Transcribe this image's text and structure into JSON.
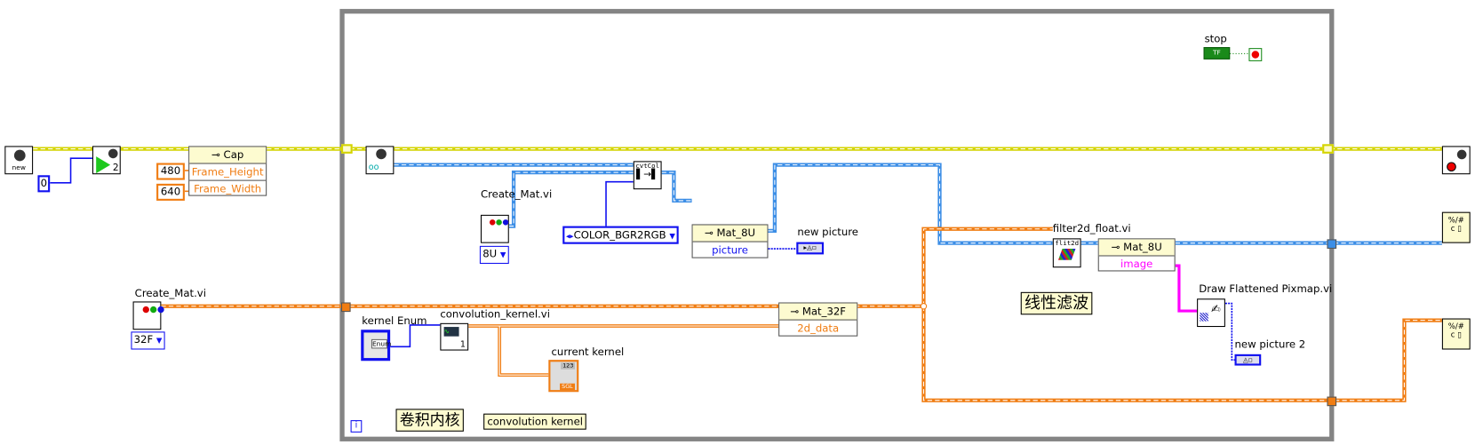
{
  "outside": {
    "new_node_text": "new",
    "camera_index_const": "0",
    "start_node_badge": "2",
    "cap_node": {
      "title": "Cap",
      "rows": [
        "Frame_Height",
        "Frame_Width"
      ]
    },
    "height_const": "480",
    "width_const": "640",
    "create_mat_label": "Create_Mat.vi",
    "create_mat_type": "32F"
  },
  "loop": {
    "stop_label": "stop",
    "stop_bool_text": "TF",
    "inner_create_mat_label": "Create_Mat.vi",
    "inner_create_mat_type": "8U",
    "cvtcolor_text": "cvtCol",
    "color_code_enum": "COLOR_BGR2RGB",
    "mat8u_node": {
      "title": "Mat_8U",
      "rows": [
        "picture"
      ]
    },
    "new_picture_label": "new picture",
    "kernel_enum_label": "kernel Enum",
    "kernel_enum_text": "Enum",
    "conv_kernel_label": "convolution_kernel.vi",
    "conv_kernel_badge": "1",
    "current_kernel_label": "current kernel",
    "current_kernel_type": "SGL",
    "current_kernel_value": "123",
    "mat32f_node": {
      "title": "Mat_32F",
      "rows": [
        "2d_data"
      ]
    },
    "filter_label": "filter2d_float.vi",
    "filter_text": "flit2d",
    "mat8u_image_node": {
      "title": "Mat_8U",
      "rows": [
        "image"
      ]
    },
    "linear_filter_note": "线性滤波",
    "draw_pixmap_label": "Draw Flattened Pixmap.vi",
    "new_picture2_label": "new picture 2",
    "conv_note_cn": "卷积内核",
    "conv_note_en": "convolution kernel",
    "info_icon_text": "i"
  },
  "colors": {
    "loop_border": "#848484",
    "refnum_wire": "#d4d400",
    "image_wire": "#3c8ee6",
    "numeric_wire": "#f07d13",
    "int_wire": "#1010f0",
    "pixmap_wire": "#ff00ff"
  }
}
